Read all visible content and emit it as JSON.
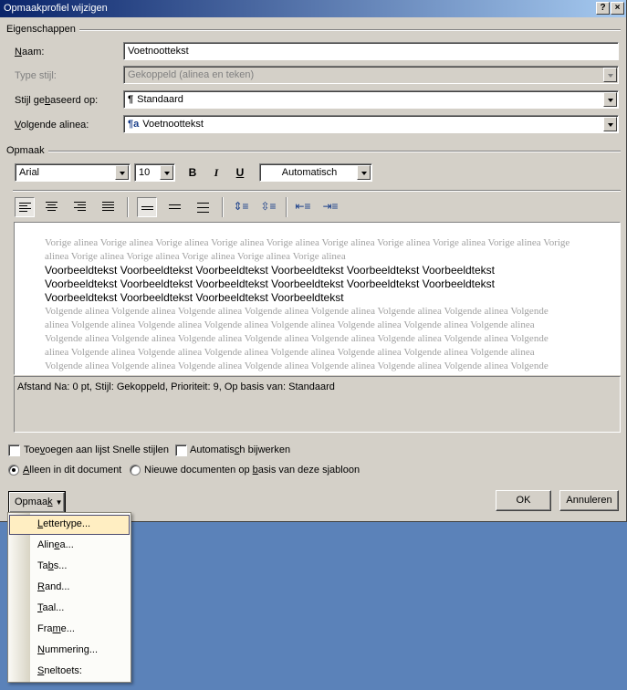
{
  "window": {
    "title": "Opmaakprofiel wijzigen",
    "help_glyph": "?",
    "close_glyph": "×"
  },
  "properties": {
    "group_label": "Eigenschappen",
    "name_label": "Naam:",
    "name_value": "Voetnoottekst",
    "type_label": "Type stijl:",
    "type_value": "Gekoppeld (alinea en teken)",
    "based_on_label": "Stijl gebaseerd op:",
    "based_on_value": "Standaard",
    "based_on_icon": "¶",
    "next_label": "Volgende alinea:",
    "next_value": "Voetnoottekst",
    "next_icon": "¶a"
  },
  "formatting": {
    "group_label": "Opmaak",
    "font_value": "Arial",
    "size_value": "10",
    "bold_glyph": "B",
    "italic_glyph": "I",
    "underline_glyph": "U",
    "color_value": "Automatisch"
  },
  "preview": {
    "previous_text": "Vorige alinea Vorige alinea Vorige alinea Vorige alinea Vorige alinea Vorige alinea Vorige alinea Vorige alinea Vorige alinea Vorige alinea Vorige alinea Vorige alinea Vorige alinea Vorige alinea Vorige alinea",
    "sample_text": "Voorbeeldtekst Voorbeeldtekst Voorbeeldtekst Voorbeeldtekst Voorbeeldtekst Voorbeeldtekst Voorbeeldtekst Voorbeeldtekst Voorbeeldtekst Voorbeeldtekst Voorbeeldtekst Voorbeeldtekst Voorbeeldtekst Voorbeeldtekst Voorbeeldtekst Voorbeeldtekst",
    "next_text": "Volgende alinea Volgende alinea Volgende alinea Volgende alinea Volgende alinea Volgende alinea Volgende alinea Volgende alinea Volgende alinea Volgende alinea Volgende alinea Volgende alinea Volgende alinea Volgende alinea Volgende alinea Volgende alinea Volgende alinea Volgende alinea Volgende alinea Volgende alinea Volgende alinea Volgende alinea Volgende alinea Volgende alinea Volgende alinea Volgende alinea Volgende alinea Volgende alinea Volgende alinea Volgende alinea Volgende alinea Volgende alinea Volgende alinea Volgende alinea Volgende alinea Volgende alinea Volgende alinea Volgende alinea Volgende alinea Volgende alinea"
  },
  "description": "Afstand Na:  0 pt, Stijl: Gekoppeld, Prioriteit: 9, Op basis van: Standaard",
  "options": {
    "add_quick_styles": "Toevoegen aan lijst Snelle stijlen",
    "auto_update": "Automatisch bijwerken",
    "only_this_document": "Alleen in dit document",
    "new_documents": "Nieuwe documenten op basis van deze sjabloon"
  },
  "buttons": {
    "format": "Opmaak",
    "ok": "OK",
    "cancel": "Annuleren"
  },
  "menu": {
    "items": [
      "Lettertype...",
      "Alinea...",
      "Tabs...",
      "Rand...",
      "Taal...",
      "Frame...",
      "Nummering...",
      "Sneltoets:"
    ],
    "highlighted": "Lettertype..."
  }
}
